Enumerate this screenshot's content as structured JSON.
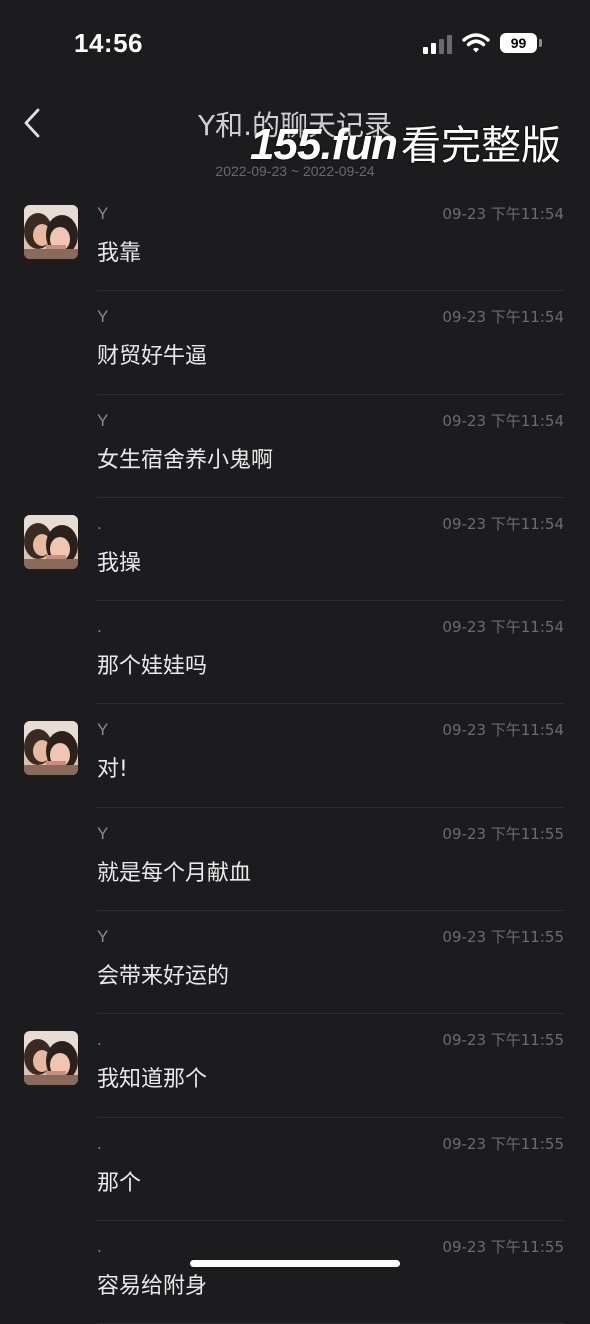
{
  "status_bar": {
    "time": "14:56",
    "battery": "99"
  },
  "header": {
    "title": "Y和.的聊天记录",
    "date_range": "2022-09-23 ~ 2022-09-24"
  },
  "watermark": {
    "domain": "155.fun",
    "text": "看完整版"
  },
  "messages": [
    {
      "sender": "Y",
      "time": "09-23 下午11:54",
      "text": "我靠",
      "show_avatar": true
    },
    {
      "sender": "Y",
      "time": "09-23 下午11:54",
      "text": "财贸好牛逼",
      "show_avatar": false
    },
    {
      "sender": "Y",
      "time": "09-23 下午11:54",
      "text": "女生宿舍养小鬼啊",
      "show_avatar": false
    },
    {
      "sender": ".",
      "time": "09-23 下午11:54",
      "text": "我操",
      "show_avatar": true
    },
    {
      "sender": ".",
      "time": "09-23 下午11:54",
      "text": "那个娃娃吗",
      "show_avatar": false
    },
    {
      "sender": "Y",
      "time": "09-23 下午11:54",
      "text": "对!",
      "show_avatar": true
    },
    {
      "sender": "Y",
      "time": "09-23 下午11:55",
      "text": "就是每个月献血",
      "show_avatar": false
    },
    {
      "sender": "Y",
      "time": "09-23 下午11:55",
      "text": "会带来好运的",
      "show_avatar": false
    },
    {
      "sender": ".",
      "time": "09-23 下午11:55",
      "text": "我知道那个",
      "show_avatar": true
    },
    {
      "sender": ".",
      "time": "09-23 下午11:55",
      "text": "那个",
      "show_avatar": false
    },
    {
      "sender": ".",
      "time": "09-23 下午11:55",
      "text": "容易给附身",
      "show_avatar": false
    }
  ],
  "colors": {
    "background": "#1c1c1e",
    "text_primary": "#e9e9eb",
    "text_secondary": "#8a8a8e",
    "divider": "#2e2e31"
  }
}
